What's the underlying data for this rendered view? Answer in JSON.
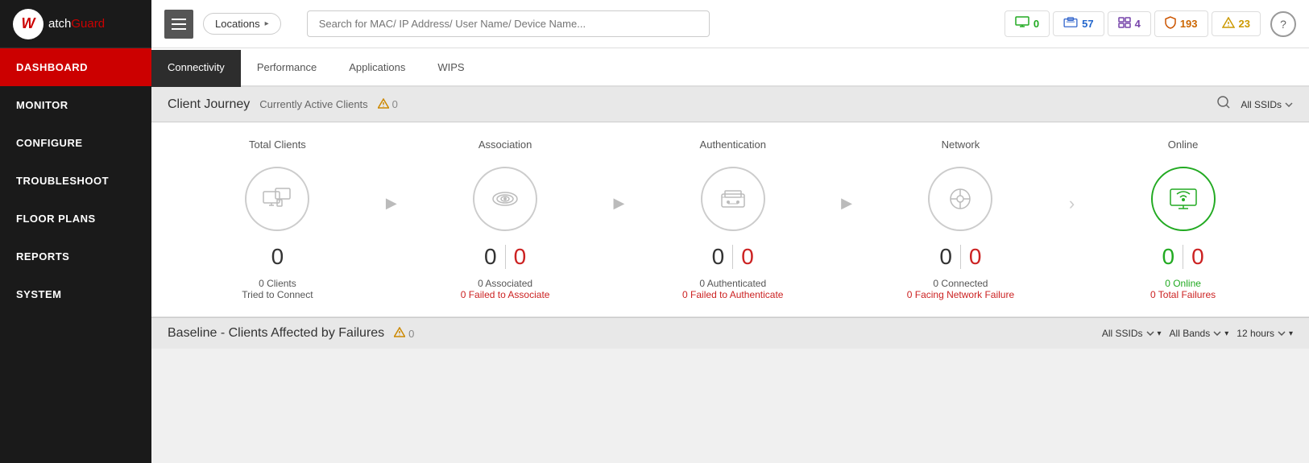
{
  "sidebar": {
    "logo": {
      "brand": "atch",
      "brand_prefix": "W",
      "brand_suffix": "Guard"
    },
    "nav_items": [
      {
        "id": "dashboard",
        "label": "DASHBOARD",
        "active": true
      },
      {
        "id": "monitor",
        "label": "MONITOR",
        "active": false
      },
      {
        "id": "configure",
        "label": "CONFIGURE",
        "active": false
      },
      {
        "id": "troubleshoot",
        "label": "TROUBLESHOOT",
        "active": false
      },
      {
        "id": "floor_plans",
        "label": "FLOOR PLANS",
        "active": false
      },
      {
        "id": "reports",
        "label": "REPORTS",
        "active": false
      },
      {
        "id": "system",
        "label": "SYSTEM",
        "active": false
      }
    ]
  },
  "topbar": {
    "location_label": "Locations",
    "search_placeholder": "Search for MAC/ IP Address/ User Name/ Device Name...",
    "badges": [
      {
        "id": "online",
        "count": "0",
        "icon": "monitor",
        "color": "green"
      },
      {
        "id": "devices",
        "count": "57",
        "icon": "device",
        "color": "blue"
      },
      {
        "id": "grid",
        "count": "4",
        "icon": "grid",
        "color": "purple"
      },
      {
        "id": "shield",
        "count": "193",
        "icon": "shield",
        "color": "orange"
      },
      {
        "id": "alert",
        "count": "23",
        "icon": "alert",
        "color": "yellow"
      }
    ],
    "help_label": "?"
  },
  "tabs": [
    {
      "id": "connectivity",
      "label": "Connectivity",
      "active": true
    },
    {
      "id": "performance",
      "label": "Performance",
      "active": false
    },
    {
      "id": "applications",
      "label": "Applications",
      "active": false
    },
    {
      "id": "wips",
      "label": "WIPS",
      "active": false
    }
  ],
  "client_journey": {
    "title": "Client Journey",
    "subtitle": "Currently Active Clients",
    "alert_count": "0",
    "ssid_label": "All SSIDs",
    "stages": [
      {
        "id": "total_clients",
        "title": "Total Clients",
        "primary_count": "0",
        "secondary_count": null,
        "primary_label": "0 Clients",
        "secondary_label": "Tried to Connect",
        "icon": "monitor",
        "online": false
      },
      {
        "id": "association",
        "title": "Association",
        "primary_count": "0",
        "secondary_count": "0",
        "primary_label": "0 Associated",
        "secondary_label": "0 Failed to Associate",
        "icon": "wifi",
        "online": false
      },
      {
        "id": "authentication",
        "title": "Authentication",
        "primary_count": "0",
        "secondary_count": "0",
        "primary_label": "0 Authenticated",
        "secondary_label": "0 Failed to Authenticate",
        "icon": "router",
        "online": false
      },
      {
        "id": "network",
        "title": "Network",
        "primary_count": "0",
        "secondary_count": "0",
        "primary_label": "0 Connected",
        "secondary_label": "0 Facing Network Failure",
        "icon": "network",
        "online": false
      },
      {
        "id": "online",
        "title": "Online",
        "primary_count": "0",
        "secondary_count": "0",
        "primary_label": "0 Online",
        "secondary_label": "0 Total Failures",
        "icon": "cloud",
        "online": true
      }
    ]
  },
  "baseline": {
    "title": "Baseline - Clients Affected by Failures",
    "alert_count": "0",
    "filters": {
      "ssid": "All SSIDs",
      "bands": "All Bands",
      "time": "12 hours"
    }
  }
}
